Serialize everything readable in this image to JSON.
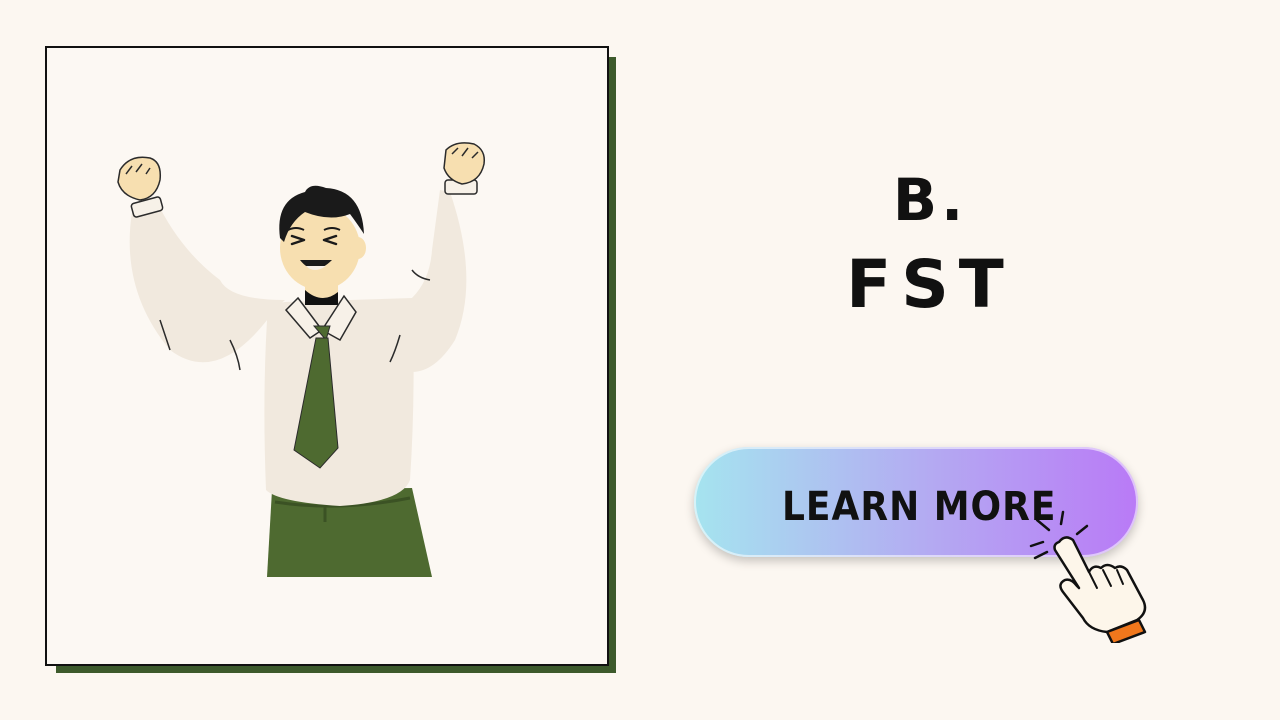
{
  "brand": {
    "mark": "B.",
    "name": "FST"
  },
  "cta": {
    "label": "LEARN MORE"
  },
  "icons": {
    "illustration": "celebrating-businessman-illustration",
    "cursor": "pointing-hand-cursor-icon"
  },
  "colors": {
    "background": "#fcf7f1",
    "frame_shadow": "#3d5a2c",
    "tie_and_pants": "#4e6a30",
    "button_gradient_start": "#a5e4ef",
    "button_gradient_end": "#b97af6",
    "cursor_cuff": "#f0771c"
  }
}
